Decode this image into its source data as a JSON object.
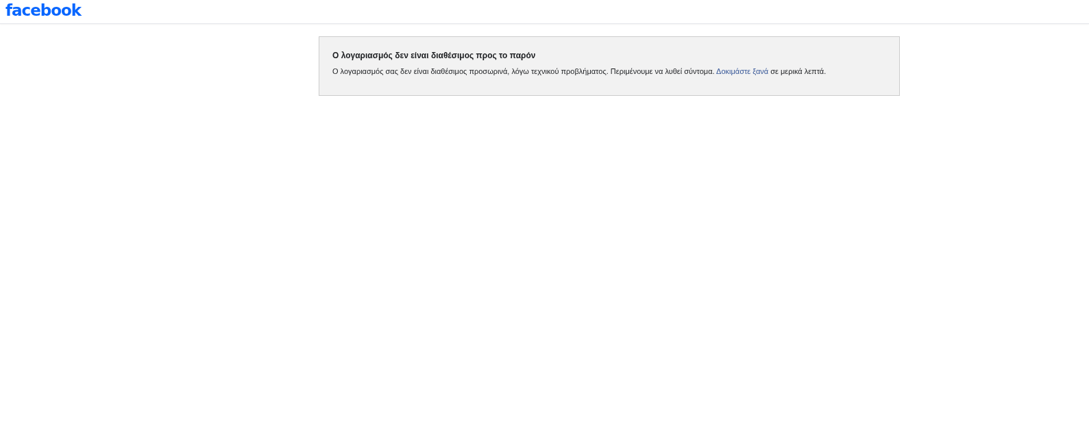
{
  "header": {
    "logo": "facebook"
  },
  "notice": {
    "title": "Ο λογαριασμός δεν είναι διαθέσιμος προς το παρόν",
    "message_before": "Ο λογαριασμός σας δεν είναι διαθέσιμος προσωρινά, λόγω τεχνικού προβλήματος. Περιμένουμε να λυθεί σύντομα.",
    "link": "Δοκιμάστε ξανά",
    "message_after": "σε μερικά λεπτά."
  }
}
